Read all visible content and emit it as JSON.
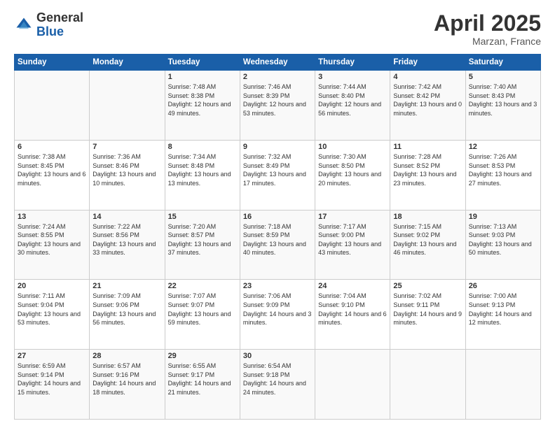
{
  "header": {
    "logo_general": "General",
    "logo_blue": "Blue",
    "title": "April 2025",
    "location": "Marzan, France"
  },
  "days_of_week": [
    "Sunday",
    "Monday",
    "Tuesday",
    "Wednesday",
    "Thursday",
    "Friday",
    "Saturday"
  ],
  "weeks": [
    {
      "days": [
        {
          "num": "",
          "info": ""
        },
        {
          "num": "",
          "info": ""
        },
        {
          "num": "1",
          "info": "Sunrise: 7:48 AM\nSunset: 8:38 PM\nDaylight: 12 hours and 49 minutes."
        },
        {
          "num": "2",
          "info": "Sunrise: 7:46 AM\nSunset: 8:39 PM\nDaylight: 12 hours and 53 minutes."
        },
        {
          "num": "3",
          "info": "Sunrise: 7:44 AM\nSunset: 8:40 PM\nDaylight: 12 hours and 56 minutes."
        },
        {
          "num": "4",
          "info": "Sunrise: 7:42 AM\nSunset: 8:42 PM\nDaylight: 13 hours and 0 minutes."
        },
        {
          "num": "5",
          "info": "Sunrise: 7:40 AM\nSunset: 8:43 PM\nDaylight: 13 hours and 3 minutes."
        }
      ]
    },
    {
      "days": [
        {
          "num": "6",
          "info": "Sunrise: 7:38 AM\nSunset: 8:45 PM\nDaylight: 13 hours and 6 minutes."
        },
        {
          "num": "7",
          "info": "Sunrise: 7:36 AM\nSunset: 8:46 PM\nDaylight: 13 hours and 10 minutes."
        },
        {
          "num": "8",
          "info": "Sunrise: 7:34 AM\nSunset: 8:48 PM\nDaylight: 13 hours and 13 minutes."
        },
        {
          "num": "9",
          "info": "Sunrise: 7:32 AM\nSunset: 8:49 PM\nDaylight: 13 hours and 17 minutes."
        },
        {
          "num": "10",
          "info": "Sunrise: 7:30 AM\nSunset: 8:50 PM\nDaylight: 13 hours and 20 minutes."
        },
        {
          "num": "11",
          "info": "Sunrise: 7:28 AM\nSunset: 8:52 PM\nDaylight: 13 hours and 23 minutes."
        },
        {
          "num": "12",
          "info": "Sunrise: 7:26 AM\nSunset: 8:53 PM\nDaylight: 13 hours and 27 minutes."
        }
      ]
    },
    {
      "days": [
        {
          "num": "13",
          "info": "Sunrise: 7:24 AM\nSunset: 8:55 PM\nDaylight: 13 hours and 30 minutes."
        },
        {
          "num": "14",
          "info": "Sunrise: 7:22 AM\nSunset: 8:56 PM\nDaylight: 13 hours and 33 minutes."
        },
        {
          "num": "15",
          "info": "Sunrise: 7:20 AM\nSunset: 8:57 PM\nDaylight: 13 hours and 37 minutes."
        },
        {
          "num": "16",
          "info": "Sunrise: 7:18 AM\nSunset: 8:59 PM\nDaylight: 13 hours and 40 minutes."
        },
        {
          "num": "17",
          "info": "Sunrise: 7:17 AM\nSunset: 9:00 PM\nDaylight: 13 hours and 43 minutes."
        },
        {
          "num": "18",
          "info": "Sunrise: 7:15 AM\nSunset: 9:02 PM\nDaylight: 13 hours and 46 minutes."
        },
        {
          "num": "19",
          "info": "Sunrise: 7:13 AM\nSunset: 9:03 PM\nDaylight: 13 hours and 50 minutes."
        }
      ]
    },
    {
      "days": [
        {
          "num": "20",
          "info": "Sunrise: 7:11 AM\nSunset: 9:04 PM\nDaylight: 13 hours and 53 minutes."
        },
        {
          "num": "21",
          "info": "Sunrise: 7:09 AM\nSunset: 9:06 PM\nDaylight: 13 hours and 56 minutes."
        },
        {
          "num": "22",
          "info": "Sunrise: 7:07 AM\nSunset: 9:07 PM\nDaylight: 13 hours and 59 minutes."
        },
        {
          "num": "23",
          "info": "Sunrise: 7:06 AM\nSunset: 9:09 PM\nDaylight: 14 hours and 3 minutes."
        },
        {
          "num": "24",
          "info": "Sunrise: 7:04 AM\nSunset: 9:10 PM\nDaylight: 14 hours and 6 minutes."
        },
        {
          "num": "25",
          "info": "Sunrise: 7:02 AM\nSunset: 9:11 PM\nDaylight: 14 hours and 9 minutes."
        },
        {
          "num": "26",
          "info": "Sunrise: 7:00 AM\nSunset: 9:13 PM\nDaylight: 14 hours and 12 minutes."
        }
      ]
    },
    {
      "days": [
        {
          "num": "27",
          "info": "Sunrise: 6:59 AM\nSunset: 9:14 PM\nDaylight: 14 hours and 15 minutes."
        },
        {
          "num": "28",
          "info": "Sunrise: 6:57 AM\nSunset: 9:16 PM\nDaylight: 14 hours and 18 minutes."
        },
        {
          "num": "29",
          "info": "Sunrise: 6:55 AM\nSunset: 9:17 PM\nDaylight: 14 hours and 21 minutes."
        },
        {
          "num": "30",
          "info": "Sunrise: 6:54 AM\nSunset: 9:18 PM\nDaylight: 14 hours and 24 minutes."
        },
        {
          "num": "",
          "info": ""
        },
        {
          "num": "",
          "info": ""
        },
        {
          "num": "",
          "info": ""
        }
      ]
    }
  ]
}
